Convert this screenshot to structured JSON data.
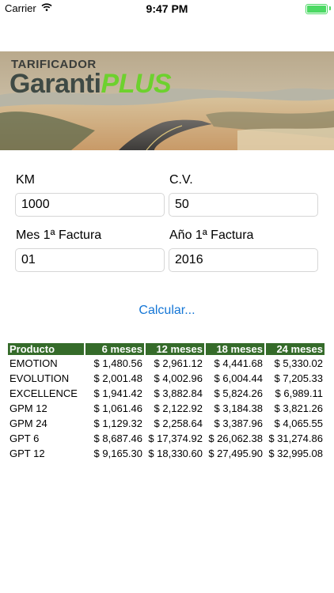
{
  "status_bar": {
    "carrier": "Carrier",
    "time": "9:47 PM"
  },
  "banner": {
    "small_title": "TARIFICADOR",
    "brand_part1": "Garanti",
    "brand_part2": "PLUS"
  },
  "form": {
    "km": {
      "label": "KM",
      "value": "1000"
    },
    "cv": {
      "label": "C.V.",
      "value": "50"
    },
    "mes": {
      "label": "Mes 1ª Factura",
      "value": "01"
    },
    "anio": {
      "label": "Año 1ª Factura",
      "value": "2016"
    }
  },
  "calculate_label": "Calcular...",
  "table": {
    "headers": [
      "Producto",
      "6 meses",
      "12 meses",
      "18 meses",
      "24 meses"
    ],
    "rows": [
      [
        "EMOTION",
        "$ 1,480.56",
        "$ 2,961.12",
        "$ 4,441.68",
        "$ 5,330.02"
      ],
      [
        "EVOLUTION",
        "$ 2,001.48",
        "$ 4,002.96",
        "$ 6,004.44",
        "$ 7,205.33"
      ],
      [
        "EXCELLENCE",
        "$ 1,941.42",
        "$ 3,882.84",
        "$ 5,824.26",
        "$ 6,989.11"
      ],
      [
        "GPM 12",
        "$ 1,061.46",
        "$ 2,122.92",
        "$ 3,184.38",
        "$ 3,821.26"
      ],
      [
        "GPM 24",
        "$ 1,129.32",
        "$ 2,258.64",
        "$ 3,387.96",
        "$ 4,065.55"
      ],
      [
        "GPT 6",
        "$ 8,687.46",
        "$ 17,374.92",
        "$ 26,062.38",
        "$ 31,274.86"
      ],
      [
        "GPT 12",
        "$ 9,165.30",
        "$ 18,330.60",
        "$ 27,495.90",
        "$ 32,995.08"
      ]
    ]
  },
  "colors": {
    "table_header_bg": "#356b2a",
    "link": "#1476d6",
    "brand_green": "#6dd12e",
    "battery": "#4cd964"
  }
}
